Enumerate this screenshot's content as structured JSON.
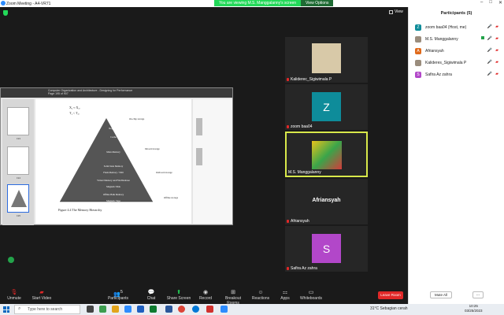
{
  "window": {
    "title": "Zoom Meeting - A4-VR71"
  },
  "banner": {
    "message": "You are viewing M.S. Manggalanny's screen",
    "view_options": "View Options"
  },
  "view_label": "View",
  "shared": {
    "doc_header_line1": "Computer Organization and Architecture - Designing for Performance",
    "doc_header_line2": "Page 195 of 907",
    "thumb_labels": [
      "193",
      "194",
      "195"
    ],
    "formula_a": "X₁ ≈ X₂,",
    "formula_b": "T₁ < T₂,",
    "pyramid_levels": [
      "Registers",
      "Cache",
      "Main Memory",
      "Solid-State Memory",
      "Flash Memory / SSD",
      "Virtual Memory and File/Database",
      "Magnetic Disk",
      "Offline Bulk Memory",
      "Magnetic Tape"
    ],
    "side_labels": [
      "On-chip storage",
      "Inboard storage",
      "Outboard storage",
      "Offline storage"
    ],
    "caption": "Figure 4.4   The Memory Hierarchy"
  },
  "participants_tiles": [
    {
      "name": "Kaliderес_Sigiwimala P",
      "type": "photo",
      "muted": true
    },
    {
      "name": "zoom baa04",
      "initial": "Z",
      "color": "#0e8c9a",
      "muted": true
    },
    {
      "name": "M.S. Manggalanny",
      "type": "photo2",
      "muted": false,
      "active": true
    },
    {
      "name": "Afriansyah",
      "big": true,
      "muted": true
    },
    {
      "name": "Safira Az zahra",
      "initial": "S",
      "color": "#b247c9",
      "muted": true
    }
  ],
  "toolbar": {
    "unmute": "Unmute",
    "start_video": "Start Video",
    "participants": "Participants",
    "participants_count": "5",
    "chat": "Chat",
    "share_screen": "Share Screen",
    "record": "Record",
    "breakout": "Breakout Rooms",
    "reactions": "Reactions",
    "apps": "Apps",
    "whiteboards": "Whiteboards",
    "leave": "Leave Room"
  },
  "panel": {
    "title": "Participants (5)",
    "items": [
      {
        "name": "zoom baa04 (Host, me)",
        "initial": "Z",
        "color": "#0e8c9a"
      },
      {
        "name": "M.S. Manggalanny",
        "photo": true,
        "video": true
      },
      {
        "name": "Afriansyah",
        "initial": "A",
        "color": "#e06a1b"
      },
      {
        "name": "Kaliderеs_Sigiwimala P",
        "photo": true
      },
      {
        "name": "Safira Az zahra",
        "initial": "S",
        "color": "#b247c9"
      }
    ],
    "mute_all": "Mute All",
    "more": "..."
  },
  "taskbar": {
    "search_placeholder": "Type here to search",
    "weather": "31°C  Sebagian cerah",
    "time": "10:25",
    "date": "03/25/2023"
  }
}
